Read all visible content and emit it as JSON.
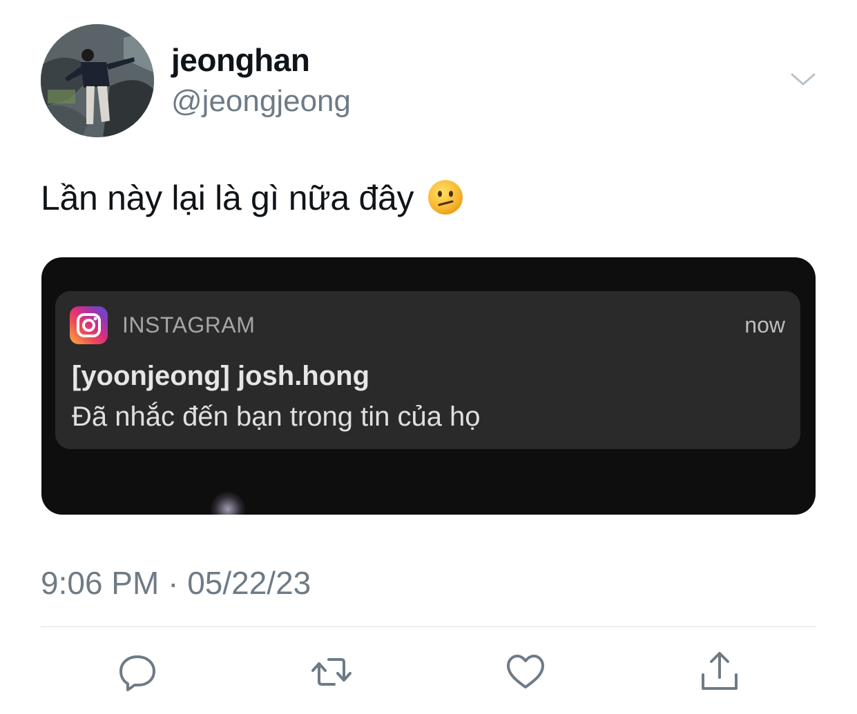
{
  "tweet": {
    "display_name": "jeonghan",
    "handle": "@jeongjeong",
    "text": "Lần này lại là gì nữa đây",
    "emoji_icon": "confused-face-emoji",
    "timestamp": "9:06 PM · 05/22/23"
  },
  "notification": {
    "app_name": "INSTAGRAM",
    "time": "now",
    "title": "[yoonjeong] josh.hong",
    "body": "Đã nhắc đến bạn trong tin của họ",
    "app_icon": "instagram-icon"
  },
  "actions": [
    {
      "icon": "reply-icon"
    },
    {
      "icon": "retweet-icon"
    },
    {
      "icon": "like-icon"
    },
    {
      "icon": "share-icon"
    }
  ],
  "colors": {
    "text_primary": "#0f1419",
    "text_secondary": "#6e7b86",
    "divider": "#dde2e6",
    "notification_bg": "#2a2a2a",
    "media_bg": "#0e0e0e"
  }
}
